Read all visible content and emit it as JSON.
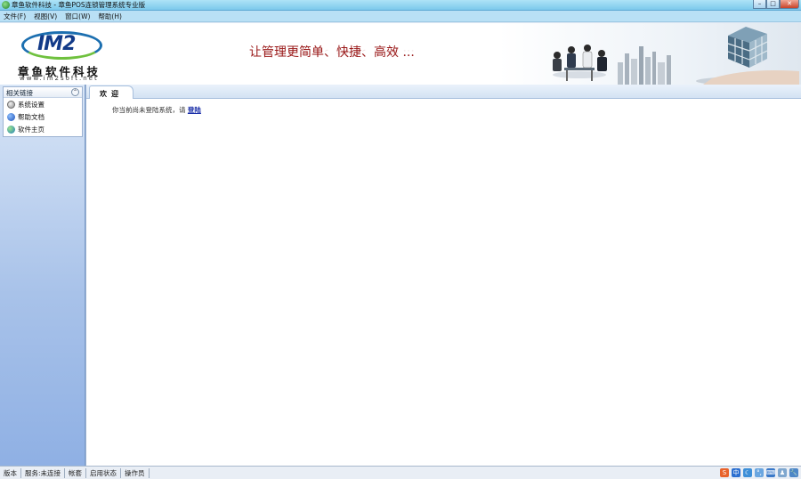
{
  "window": {
    "title": "章鱼软件科技 - 章鱼POS连锁管理系统专业版",
    "minimize": "–",
    "maximize": "□",
    "close": "✕"
  },
  "menu": [
    {
      "label": "文件(F)"
    },
    {
      "label": "视图(V)"
    },
    {
      "label": "窗口(W)"
    },
    {
      "label": "帮助(H)"
    }
  ],
  "banner": {
    "logo_text": "IM2",
    "company_name": "章鱼软件科技",
    "website": "www.im2soft.net",
    "slogan": "让管理更简单、快捷、高效 ...",
    "colors": {
      "slogan": "#9a1a1a",
      "logo": "#123a88"
    }
  },
  "sidebar": {
    "header": "相关链接",
    "collapse_icon": "chevron-up-icon",
    "items": [
      {
        "label": "系统设置",
        "icon": "settings-icon"
      },
      {
        "label": "帮助文档",
        "icon": "help-icon"
      },
      {
        "label": "软件主页",
        "icon": "home-globe-icon"
      }
    ]
  },
  "tabs": [
    {
      "label": "欢迎",
      "active": true
    }
  ],
  "main": {
    "welcome_text": "你当前尚未登陆系统，请",
    "login_link": "登陆"
  },
  "statusbar": {
    "cells": [
      "版本",
      "服务:未连接",
      "帐套",
      "启用状态",
      "操作员"
    ],
    "tray_icons": [
      "sogou-icon",
      "chinese-input-icon",
      "moon-icon",
      "punctuation-icon",
      "keyboard-icon",
      "user-icon",
      "wrench-icon"
    ],
    "tray_labels": [
      "S",
      "中",
      "☾",
      "°,",
      "⌨",
      "♟",
      "🔧"
    ]
  }
}
